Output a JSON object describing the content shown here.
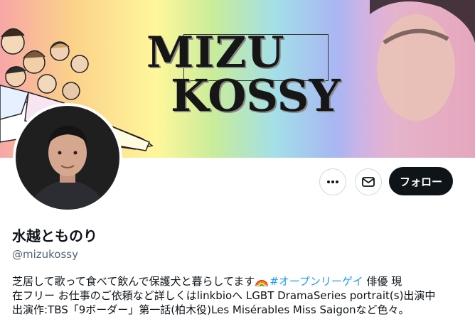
{
  "banner": {
    "logo_line1": "MIZU",
    "logo_line2": "KOSSY"
  },
  "profile": {
    "display_name": "水越とものり",
    "handle": "@mizukossy",
    "follow_label": "フォロー",
    "more_icon": "more-horizontal-icon",
    "message_icon": "envelope-icon"
  },
  "bio": {
    "line1_pre": "芝居して歌って食べて飲んで保護犬と暮らしてます",
    "emoji": "rainbow-emoji",
    "hashtag": "#オープンリーゲイ",
    "line1_post": " 俳優 現",
    "line2": "在フリー お仕事のご依頼など詳しくはlinkbioへ LGBT DramaSeries portrait(s)出演中",
    "line3": "出演作:TBS「9ボーダー」第一話(柏木役)Les Misérables Miss Saigonなど色々。"
  },
  "colors": {
    "follow_bg": "#0f1419",
    "hashtag": "#1d9bf0",
    "handle": "#536471"
  }
}
